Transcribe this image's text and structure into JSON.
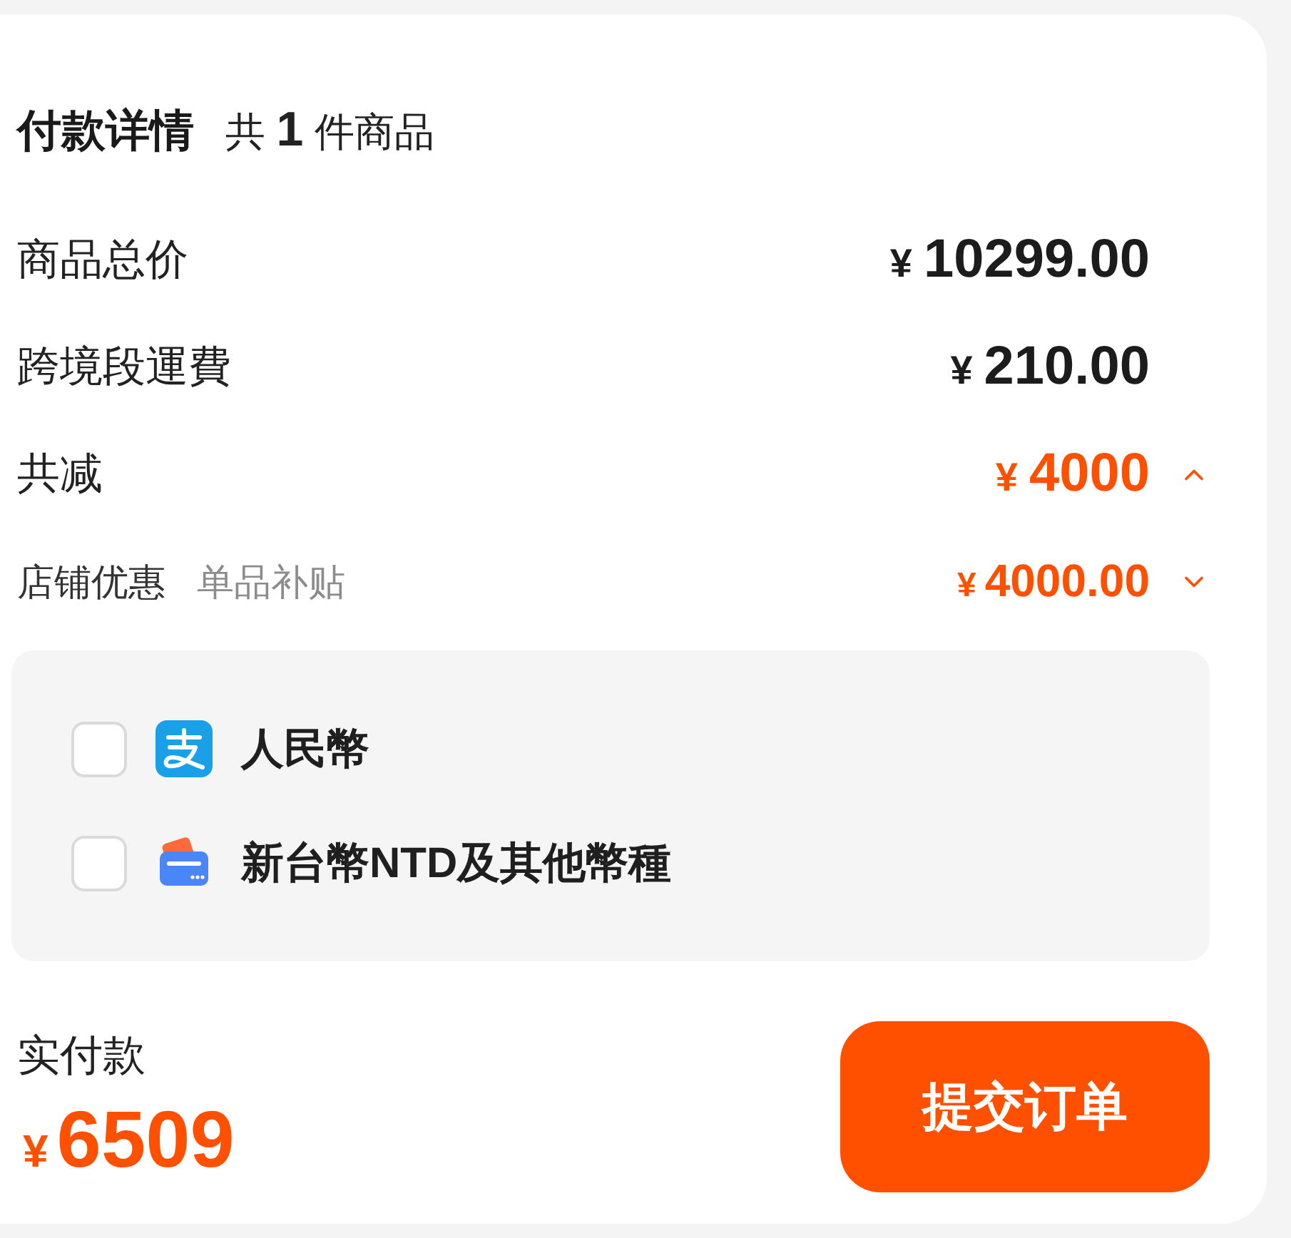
{
  "header": {
    "title": "付款详情",
    "summary": "共 **1** 件商品"
  },
  "rows": [
    {
      "kind": "charge",
      "label": "商品总价",
      "currency": "¥",
      "amount": "10299.00"
    },
    {
      "kind": "charge",
      "label": "跨境段運費",
      "currency": "¥",
      "amount": "210.00"
    },
    {
      "kind": "discount_total",
      "label": "共减",
      "currency": "¥",
      "amount": "4000",
      "expanded": true
    },
    {
      "kind": "discount_item",
      "label": "店铺优惠",
      "note": "单品补贴",
      "currency": "¥",
      "amount": "4000.00",
      "expanded": false
    }
  ],
  "payment_options": [
    {
      "kind": "alipay",
      "label": "人民幣",
      "checked": false
    },
    {
      "kind": "card",
      "label": "新台幣NTD及其他幣種",
      "checked": false
    }
  ],
  "total": {
    "label": "实付款",
    "currency": "¥",
    "amount": "6509"
  },
  "submit_button": {
    "label": "提交订单"
  }
}
